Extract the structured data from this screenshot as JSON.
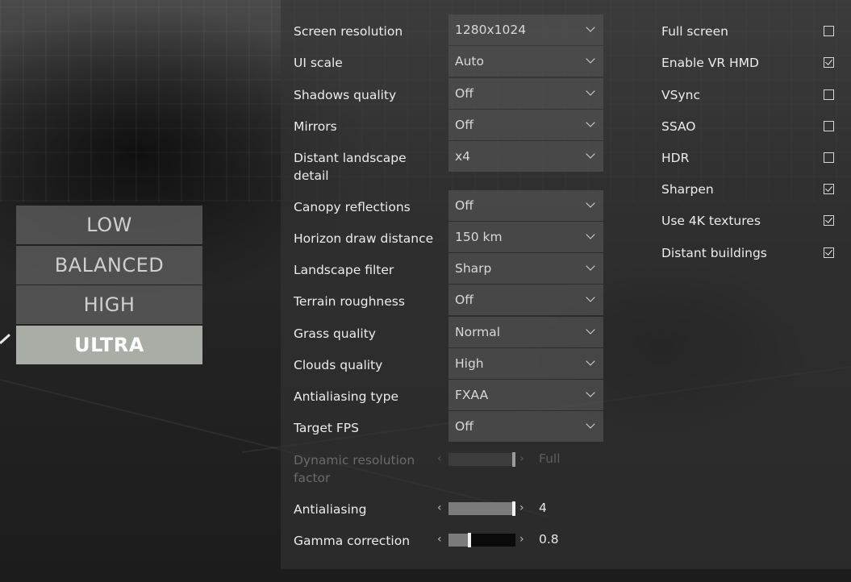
{
  "presets": [
    {
      "label": "LOW",
      "active": false
    },
    {
      "label": "BALANCED",
      "active": false
    },
    {
      "label": "HIGH",
      "active": false
    },
    {
      "label": "ULTRA",
      "active": true
    }
  ],
  "settings": [
    {
      "label": "Screen resolution",
      "value": "1280x1024"
    },
    {
      "label": "UI scale",
      "value": "Auto"
    },
    {
      "label": "Shadows quality",
      "value": "Off"
    },
    {
      "label": "Mirrors",
      "value": "Off"
    },
    {
      "label": "Distant landscape detail",
      "value": "x4"
    },
    {
      "label": "Canopy reflections",
      "value": "Off"
    },
    {
      "label": "Horizon draw distance",
      "value": "150 km"
    },
    {
      "label": "Landscape filter",
      "value": "Sharp"
    },
    {
      "label": "Terrain roughness",
      "value": "Off"
    },
    {
      "label": "Grass quality",
      "value": "Normal"
    },
    {
      "label": "Clouds quality",
      "value": "High"
    },
    {
      "label": "Antialiasing type",
      "value": "FXAA"
    },
    {
      "label": "Target FPS",
      "value": "Off"
    }
  ],
  "sliders": [
    {
      "label": "Dynamic resolution factor",
      "value": "Full",
      "level": 1.0,
      "disabled": true
    },
    {
      "label": "Antialiasing",
      "value": "4",
      "level": 1.0,
      "disabled": false
    },
    {
      "label": "Gamma correction",
      "value": "0.8",
      "level": 0.3,
      "disabled": false
    }
  ],
  "slider_arrows": {
    "left": "‹",
    "right": "›"
  },
  "checkboxes": [
    {
      "label": "Full screen",
      "checked": false
    },
    {
      "label": "Enable VR HMD",
      "checked": true
    },
    {
      "label": "VSync",
      "checked": false
    },
    {
      "label": "SSAO",
      "checked": false
    },
    {
      "label": "HDR",
      "checked": false
    },
    {
      "label": "Sharpen",
      "checked": true
    },
    {
      "label": "Use 4K textures",
      "checked": true
    },
    {
      "label": "Distant buildings",
      "checked": true
    }
  ]
}
